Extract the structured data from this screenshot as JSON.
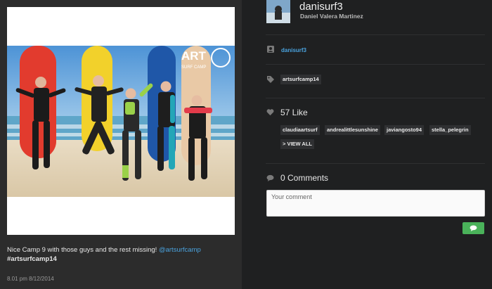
{
  "post": {
    "caption_text": "Nice Camp 9 with those guys and the rest missing! ",
    "caption_mention": "@artsurfcamp",
    "caption_hashtag": "#artsurfcamp14",
    "timestamp": "8.01 pm 8/12/2014",
    "photo_logo_text": "ART",
    "photo_logo_subtext": "SURF CAMP"
  },
  "author": {
    "username": "danisurf3",
    "full_name": "Daniel Valera Martinez",
    "avatar_icon": "avatar-photo"
  },
  "owner_row": {
    "icon": "user-badge-icon",
    "link": "danisurf3"
  },
  "tags_row": {
    "icon": "tag-icon",
    "tags": [
      "artsurfcamp14"
    ]
  },
  "likes": {
    "icon": "heart-icon",
    "title": "57 Like",
    "users": [
      "claudiaartsurf",
      "andrealittlesunshine",
      "javiangosto94",
      "stella_pelegrin"
    ],
    "view_all": "> VIEW ALL"
  },
  "comments": {
    "icon": "speech-bubble-icon",
    "title": "0 Comments",
    "placeholder": "Your comment",
    "send_icon": "chat-bubble-icon"
  },
  "colors": {
    "link": "#4aa3df",
    "send_button": "#4ab25a",
    "panel_dark": "#1f2021",
    "panel_left": "#2c2c2c"
  }
}
